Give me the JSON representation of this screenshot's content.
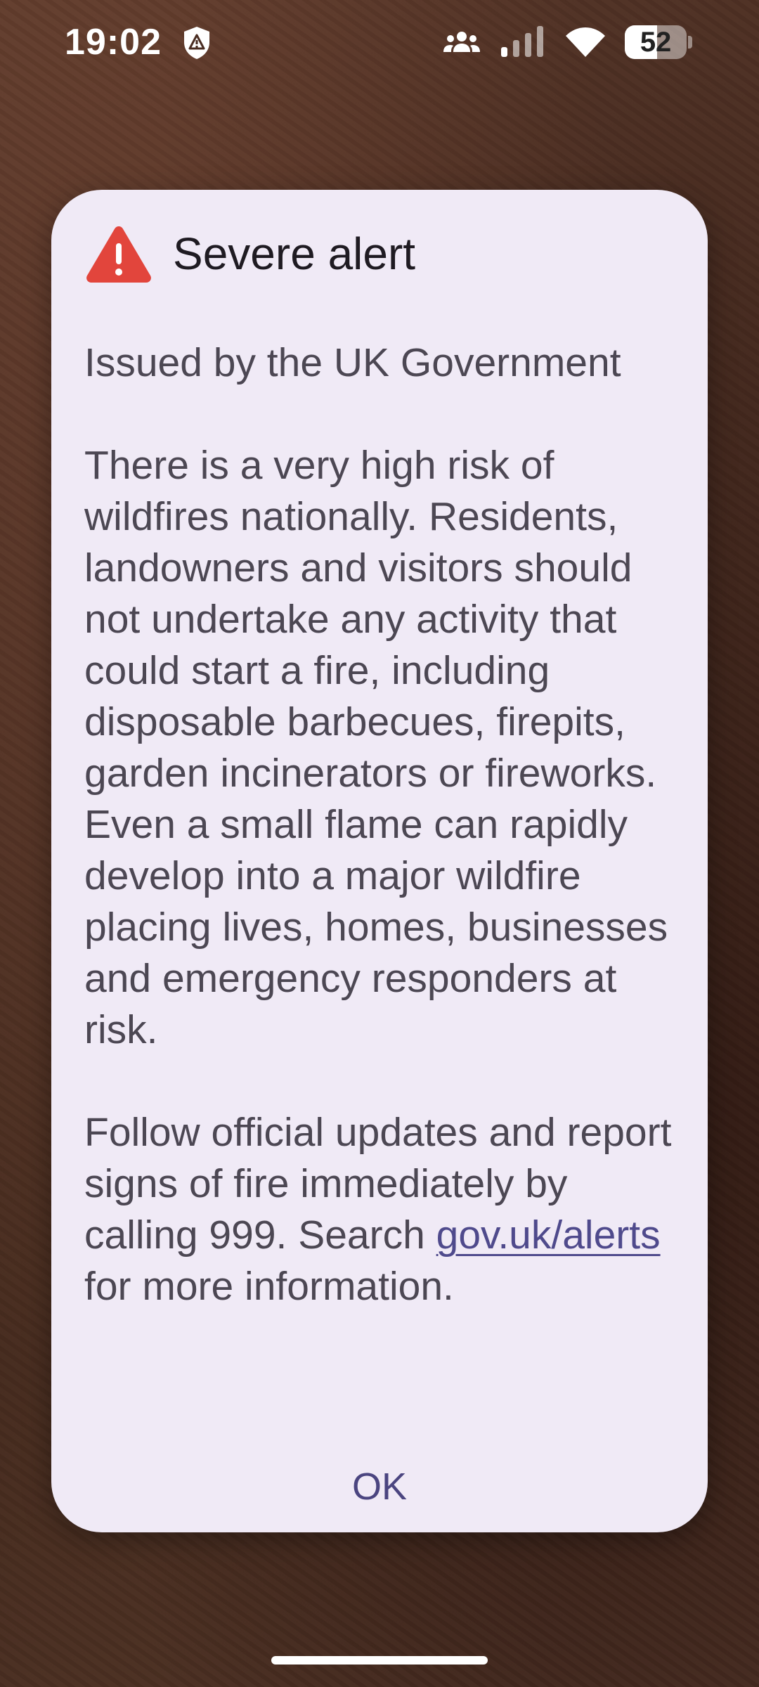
{
  "status_bar": {
    "time": "19:02",
    "battery_level": "52",
    "battery_percent": 52,
    "icons": [
      "alert-shield-icon",
      "group-icon",
      "signal-icon",
      "wifi-icon",
      "battery-icon"
    ]
  },
  "dialog": {
    "title": "Severe alert",
    "icon": "warning-triangle-icon",
    "accent_color": "#e2453c",
    "issuer": "Issued by the UK Government",
    "paragraph1": "There is a very high risk of wildfires nationally. Residents, landowners and visitors should not undertake any activity that could start a fire, including disposable barbecues, firepits, garden incinerators or fireworks. Even a small flame can rapidly develop into a major wildfire placing lives, homes, businesses and emergency responders at risk.",
    "paragraph2_part1": "Follow official updates and report signs of fire immediately by calling 999. Search ",
    "link_text": "gov.uk/alerts",
    "paragraph2_part2": " for more information.",
    "ok_label": "OK"
  }
}
